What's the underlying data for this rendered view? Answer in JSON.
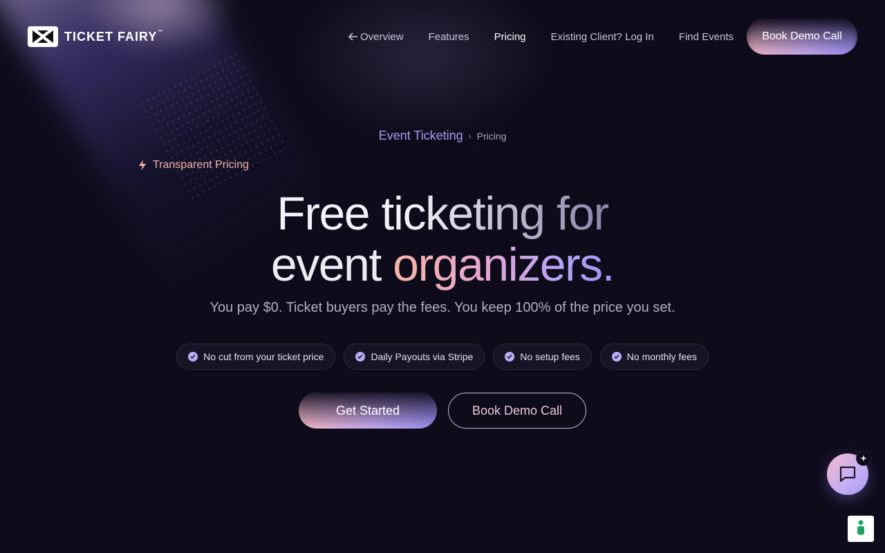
{
  "brand": {
    "name": "TICKET FAIRY",
    "tm": "™"
  },
  "nav": {
    "overview": "Overview",
    "features": "Features",
    "pricing": "Pricing",
    "login": "Existing Client? Log In",
    "find_events": "Find Events",
    "demo_button": "Book Demo Call"
  },
  "breadcrumb": {
    "parent": "Event Ticketing",
    "separator": "›",
    "current": "Pricing"
  },
  "hero": {
    "badge": "Transparent Pricing",
    "headline_line1": "Free ticketing for",
    "headline_line2_a": "event ",
    "headline_line2_b": "organizers.",
    "subtitle": "You pay $0. Ticket buyers pay the fees. You keep 100% of the price you set."
  },
  "features": [
    "No cut from your ticket price",
    "Daily Payouts via Stripe",
    "No setup fees",
    "No monthly fees"
  ],
  "cta": {
    "primary": "Get Started",
    "secondary": "Book Demo Call"
  },
  "colors": {
    "background": "#0e0c1b",
    "accent_pink": "#f4b8c6",
    "accent_purple": "#9a8ff0",
    "breadcrumb_link": "#a89cf0",
    "badge": "#f3b5a8"
  },
  "icons": {
    "back_arrow": "arrow-left-icon",
    "badge": "lightning-icon",
    "feature_check": "check-circle-icon",
    "chat": "chat-bubble-icon",
    "chat_spark": "sparkle-icon",
    "cookie": "accessibility-person-icon"
  }
}
